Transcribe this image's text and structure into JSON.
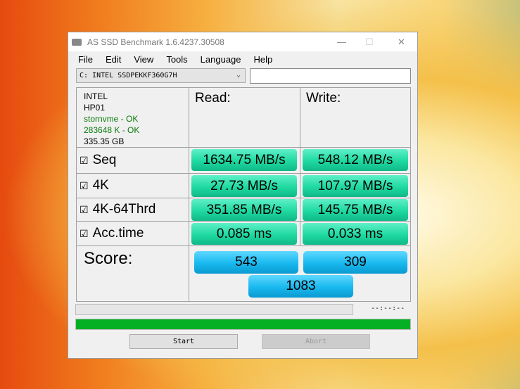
{
  "window": {
    "title": "AS SSD Benchmark 1.6.4237.30508"
  },
  "menu": [
    "File",
    "Edit",
    "View",
    "Tools",
    "Language",
    "Help"
  ],
  "drive_select": "C: INTEL SSDPEKKF360G7H",
  "info": {
    "vendor": "INTEL",
    "firmware": "HP01",
    "driver": "stornvme - OK",
    "alignment": "283648 K - OK",
    "size": "335.35 GB"
  },
  "headers": {
    "read": "Read:",
    "write": "Write:"
  },
  "rows": [
    {
      "label": "Seq",
      "checked": true,
      "read": "1634.75 MB/s",
      "write": "548.12 MB/s"
    },
    {
      "label": "4K",
      "checked": true,
      "read": "27.73 MB/s",
      "write": "107.97 MB/s"
    },
    {
      "label": "4K-64Thrd",
      "checked": true,
      "read": "351.85 MB/s",
      "write": "145.75 MB/s"
    },
    {
      "label": "Acc.time",
      "checked": true,
      "read": "0.085 ms",
      "write": "0.033 ms"
    }
  ],
  "score": {
    "label": "Score:",
    "read": "543",
    "write": "309",
    "total": "1083"
  },
  "progress": {
    "time": "--:--:--",
    "test_progress": 0,
    "total_progress": 100
  },
  "buttons": {
    "start": "Start",
    "abort": "Abort"
  },
  "checkbox_glyph": "☑"
}
